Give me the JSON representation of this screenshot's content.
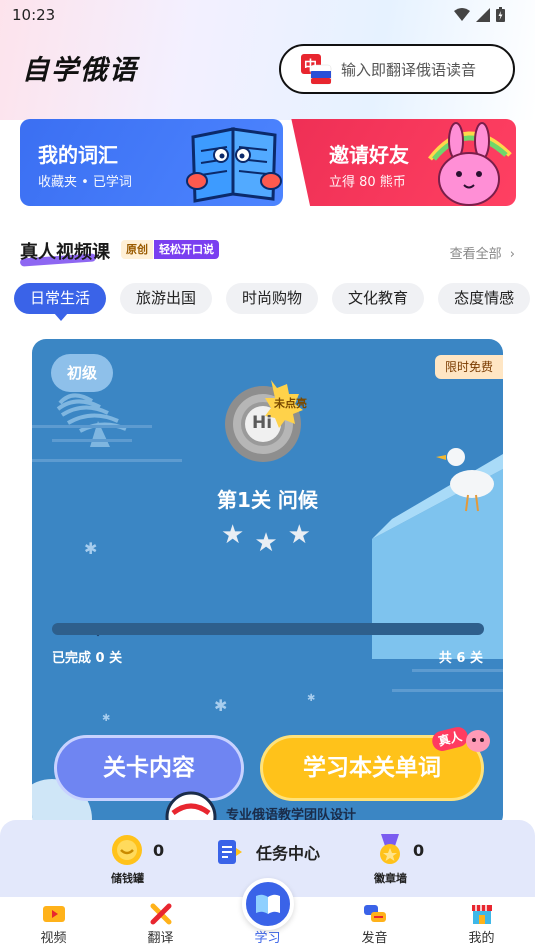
{
  "status_bar": {
    "time": "10:23"
  },
  "header": {
    "title": "自学俄语",
    "search_placeholder": "输入即翻译俄语读音",
    "flag_char": "中"
  },
  "promos": [
    {
      "title": "我的词汇",
      "subtitle": "收藏夹 • 已学词"
    },
    {
      "title": "邀请好友",
      "subtitle": "立得 80 熊币"
    }
  ],
  "video_section": {
    "title": "真人视频课",
    "badge_original": "原创",
    "badge_easy": "轻松开口说",
    "view_all": "查看全部"
  },
  "categories": [
    "日常生活",
    "旅游出国",
    "时尚购物",
    "文化教育",
    "态度情感"
  ],
  "active_category": 0,
  "lesson_card": {
    "level": "初级",
    "free_badge": "限时免费",
    "medal_text": "Hi",
    "not_lit_tag": "未点亮",
    "lesson_title": "第1关 问候",
    "stars_earned": 0,
    "stars_total": 3,
    "progress_completed": 0,
    "progress_total": 6,
    "completed_text": "已完成 0 关",
    "total_text": "共 6 关",
    "btn_content": "关卡内容",
    "btn_words": "学习本关单词",
    "real_tag": "真人",
    "team_text": "专业俄语教学团队设计"
  },
  "task_bar": {
    "piggy_count": "0",
    "piggy_label": "储钱罐",
    "task_center": "任务中心",
    "badge_count": "0",
    "badge_label": "徽章墙"
  },
  "nav": [
    {
      "label": "视频"
    },
    {
      "label": "翻译"
    },
    {
      "label": "学习"
    },
    {
      "label": "发音"
    },
    {
      "label": "我的"
    }
  ],
  "active_nav": 2,
  "colors": {
    "primary": "#3a63e8",
    "card_bg": "#3b86c4",
    "invite_red": "#ee2f55",
    "gold": "#ffc21a"
  }
}
